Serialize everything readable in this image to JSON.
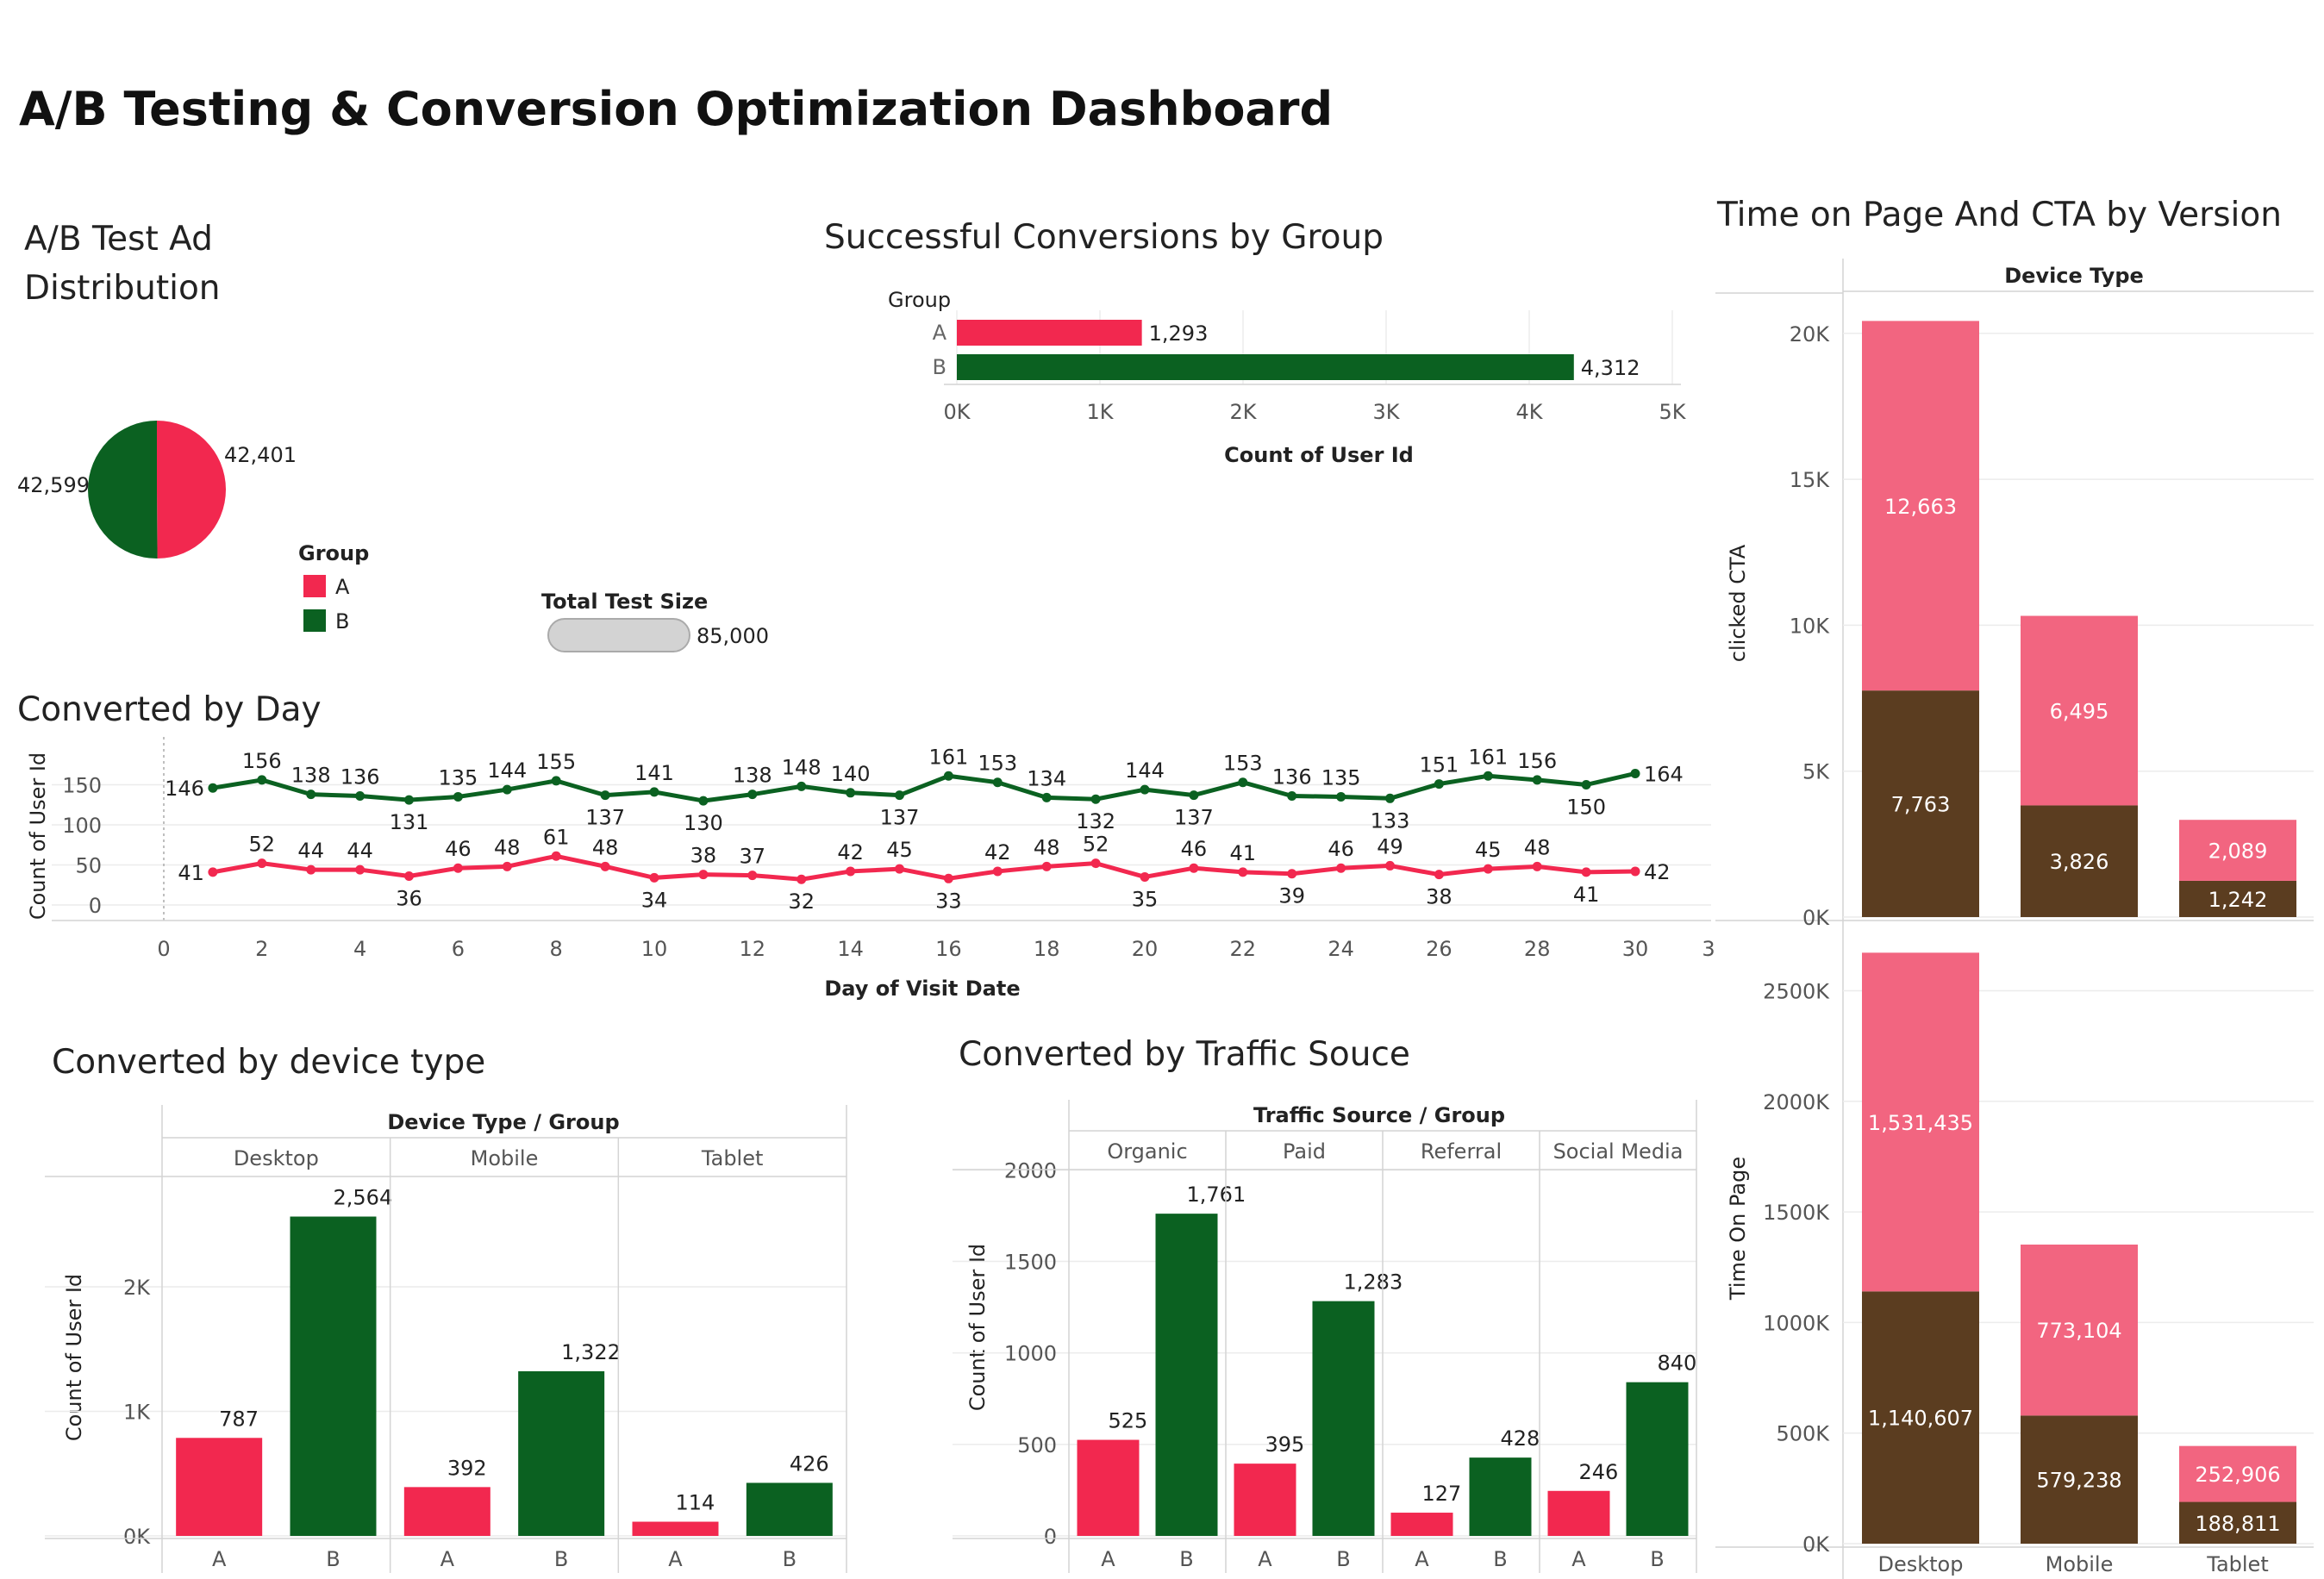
{
  "title": "A/B Testing & Conversion Optimization Dashboard",
  "colors": {
    "A": "#F2284F",
    "B": "#0B6121",
    "clicked": "#F26580",
    "unclicked": "#5B3D20"
  },
  "chart_data": [
    {
      "id": "distribution",
      "type": "pie",
      "title": "A/B Test Ad Distribution",
      "title_lines": [
        "A/B Test Ad",
        "Distribution"
      ],
      "categories": [
        "A",
        "B"
      ],
      "values": [
        42401,
        42599
      ],
      "value_labels": [
        "42,401",
        "42,599"
      ],
      "legend_title": "Group",
      "legend": [
        "A",
        "B"
      ],
      "total_label": "Total Test Size",
      "total_value": "85,000"
    },
    {
      "id": "conversions-by-group",
      "type": "bar",
      "orientation": "horizontal",
      "title": "Successful Conversions by Group",
      "row_header": "Group",
      "categories": [
        "A",
        "B"
      ],
      "values": [
        1293,
        4312
      ],
      "value_labels": [
        "1,293",
        "4,312"
      ],
      "xlabel": "Count of User Id",
      "xlim": [
        0,
        5000
      ],
      "xticks": [
        "0K",
        "1K",
        "2K",
        "3K",
        "4K",
        "5K"
      ]
    },
    {
      "id": "converted-by-day",
      "type": "line",
      "title": "Converted by Day",
      "xlabel": "Day of Visit Date",
      "ylabel": "Count of User Id",
      "xlim": [
        0,
        31
      ],
      "xticks": [
        "0",
        "2",
        "4",
        "6",
        "8",
        "10",
        "12",
        "14",
        "16",
        "18",
        "20",
        "22",
        "24",
        "26",
        "28",
        "30",
        "3"
      ],
      "yticks": [
        "150",
        "100",
        "50",
        "0"
      ],
      "x": [
        1,
        2,
        3,
        4,
        5,
        6,
        7,
        8,
        9,
        10,
        11,
        12,
        13,
        14,
        15,
        16,
        17,
        18,
        19,
        20,
        21,
        22,
        23,
        24,
        25,
        26,
        27,
        28,
        29,
        30
      ],
      "series": [
        {
          "name": "B",
          "values": [
            146,
            156,
            138,
            136,
            131,
            135,
            144,
            155,
            137,
            141,
            130,
            138,
            148,
            140,
            137,
            161,
            153,
            134,
            132,
            144,
            137,
            153,
            136,
            135,
            133,
            151,
            161,
            156,
            150,
            164
          ]
        },
        {
          "name": "A",
          "values": [
            41,
            52,
            44,
            44,
            36,
            46,
            48,
            61,
            48,
            34,
            38,
            37,
            32,
            42,
            45,
            33,
            42,
            48,
            52,
            35,
            46,
            41,
            39,
            46,
            49,
            38,
            45,
            48,
            41,
            42
          ]
        }
      ]
    },
    {
      "id": "converted-by-device",
      "type": "bar",
      "title": "Converted by device type",
      "header": "Device Type  /  Group",
      "panes": [
        "Desktop",
        "Mobile",
        "Tablet"
      ],
      "categories": [
        "A",
        "B"
      ],
      "ylabel": "Count of User Id",
      "ylim": [
        0,
        3000
      ],
      "yticks": [
        "2K",
        "1K",
        "0K"
      ],
      "series": [
        {
          "name": "A",
          "values": [
            787,
            392,
            114
          ],
          "value_labels": [
            "787",
            "392",
            "114"
          ]
        },
        {
          "name": "B",
          "values": [
            2564,
            1322,
            426
          ],
          "value_labels": [
            "2,564",
            "1,322",
            "426"
          ]
        }
      ]
    },
    {
      "id": "converted-by-traffic",
      "type": "bar",
      "title": "Converted by Traffic Souce",
      "header": "Traffic Source  /  Group",
      "panes": [
        "Organic",
        "Paid",
        "Referral",
        "Social Media"
      ],
      "categories": [
        "A",
        "B"
      ],
      "ylabel": "Count of User Id",
      "ylim": [
        0,
        2200
      ],
      "yticks": [
        "2000",
        "1500",
        "1000",
        "500",
        "0"
      ],
      "series": [
        {
          "name": "A",
          "values": [
            525,
            395,
            127,
            246
          ],
          "value_labels": [
            "525",
            "395",
            "127",
            "246"
          ]
        },
        {
          "name": "B",
          "values": [
            1761,
            1283,
            428,
            840
          ],
          "value_labels": [
            "1,761",
            "1,283",
            "428",
            "840"
          ]
        }
      ]
    },
    {
      "id": "time-cta-by-version",
      "type": "bar",
      "stacked": true,
      "title": "Time on Page And CTA by Version",
      "header": "Device Type",
      "categories": [
        "Desktop",
        "Mobile",
        "Tablet"
      ],
      "panels": [
        {
          "ylabel": "clicked CTA",
          "ylim": [
            0,
            22000
          ],
          "yticks": [
            "20K",
            "15K",
            "10K",
            "5K",
            "0K"
          ],
          "series": [
            {
              "name": "lower",
              "values": [
                7763,
                3826,
                1242
              ],
              "value_labels": [
                "7,763",
                "3,826",
                "1,242"
              ]
            },
            {
              "name": "upper",
              "values": [
                12663,
                6495,
                2089
              ],
              "value_labels": [
                "12,663",
                "6,495",
                "2,089"
              ]
            }
          ]
        },
        {
          "ylabel": "Time On Page",
          "ylim": [
            0,
            2800000
          ],
          "yticks": [
            "2500K",
            "2000K",
            "1500K",
            "1000K",
            "500K",
            "0K"
          ],
          "series": [
            {
              "name": "lower",
              "values": [
                1140607,
                579238,
                188811
              ],
              "value_labels": [
                "1,140,607",
                "579,238",
                "188,811"
              ]
            },
            {
              "name": "upper",
              "values": [
                1531435,
                773104,
                252906
              ],
              "value_labels": [
                "1,531,435",
                "773,104",
                "252,906"
              ]
            }
          ]
        }
      ]
    }
  ]
}
